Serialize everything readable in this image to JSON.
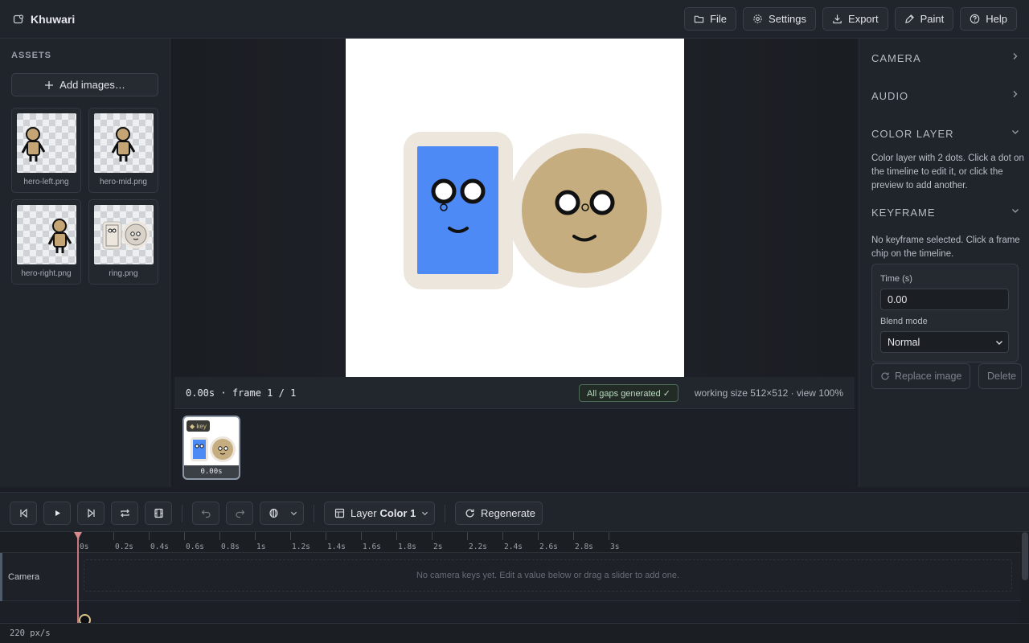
{
  "app": {
    "title": "Khuwari"
  },
  "topbar": {
    "file": "File",
    "settings": "Settings",
    "export": "Export",
    "paint": "Paint",
    "help": "Help"
  },
  "assets": {
    "title": "ASSETS",
    "add_label": "Add images…",
    "items": [
      {
        "name": "hero-left.png"
      },
      {
        "name": "hero-mid.png"
      },
      {
        "name": "hero-right.png"
      },
      {
        "name": "ring.png"
      }
    ]
  },
  "preview": {
    "timecode": "0.00s",
    "frame_label": "frame",
    "frame_current": "1",
    "frame_total": "1",
    "gaps_badge": "All gaps generated ✓",
    "working_size": "working size 512×512 · view 100%"
  },
  "frames": [
    {
      "key_label": "◆ key",
      "time": "0.00s"
    }
  ],
  "inspector": {
    "camera": "CAMERA",
    "audio": "AUDIO",
    "color_layer": "COLOR LAYER",
    "color_layer_desc": "Color layer with 2 dots. Click a dot on the timeline to edit it, or click the preview to add another.",
    "keyframe": "KEYFRAME",
    "keyframe_desc": "No keyframe selected. Click a frame chip on the timeline.",
    "time_label": "Time (s)",
    "time_value": "0.00",
    "blend_label": "Blend mode",
    "blend_value": "Normal",
    "replace_label": "Replace image",
    "delete_label": "Delete"
  },
  "toolbar": {
    "layer_prefix": "Layer",
    "layer_name": "Color 1",
    "regenerate": "Regenerate"
  },
  "timeline": {
    "ticks": [
      "0s",
      "0.2s",
      "0.4s",
      "0.6s",
      "0.8s",
      "1s",
      "1.2s",
      "1.4s",
      "1.6s",
      "1.8s",
      "2s",
      "2.2s",
      "2.4s",
      "2.6s",
      "2.8s",
      "3s"
    ],
    "camera_track": "Camera",
    "camera_empty": "No camera keys yet. Edit a value below or drag a slider to add one.",
    "zoom": "220 px/s"
  },
  "colors": {
    "accent_gold": "#d9c48b",
    "playhead": "#c9777a",
    "success": "#b9d8c0"
  }
}
